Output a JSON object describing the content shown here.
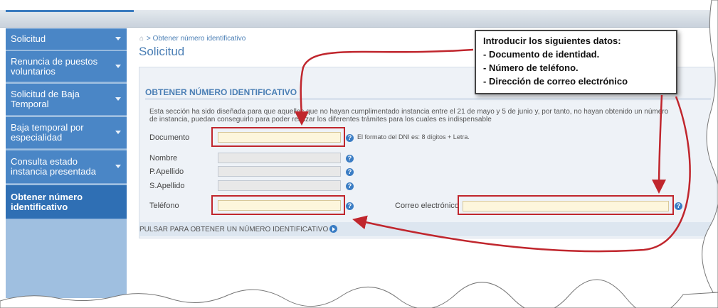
{
  "sidebar": {
    "items": [
      {
        "label": "Solicitud"
      },
      {
        "label": "Renuncia de puestos voluntarios"
      },
      {
        "label": "Solicitud de Baja Temporal"
      },
      {
        "label": "Baja temporal por especialidad"
      },
      {
        "label": "Consulta estado instancia presentada"
      },
      {
        "label": "Obtener número identificativo"
      }
    ]
  },
  "breadcrumb": {
    "separator": ">",
    "current": "Obtener número identificativo"
  },
  "page_title": "Solicitud",
  "section": {
    "title": "OBTENER NÚMERO IDENTIFICATIVO",
    "description": "Esta sección ha sido diseñada para que aquellos que no hayan cumplimentado instancia entre el 21 de mayo y 5 de junio y, por tanto, no hayan obtenido un número de instancia, puedan conseguirlo para poder realizar los diferentes trámites para los cuales es indispensable"
  },
  "form": {
    "documento_label": "Documento",
    "documento_value": "",
    "documento_hint": "El formato del DNI es: 8 dígitos + Letra.",
    "nombre_label": "Nombre",
    "papellido_label": "P.Apellido",
    "sapellido_label": "S.Apellido",
    "telefono_label": "Teléfono",
    "telefono_value": "",
    "correo_label": "Correo electrónico",
    "correo_value": "",
    "help_glyph": "?"
  },
  "action": {
    "label": "PULSAR PARA OBTENER UN NÚMERO IDENTIFICATIVO"
  },
  "callout": {
    "title": "Introducir los siguientes datos:",
    "lines": [
      "- Documento de identidad.",
      "- Número de teléfono.",
      "- Dirección de correo electrónico"
    ]
  },
  "colors": {
    "annotation_red": "#c0262d",
    "sidebar_blue": "#4a86c6",
    "field_highlight": "#fdf6dc"
  }
}
